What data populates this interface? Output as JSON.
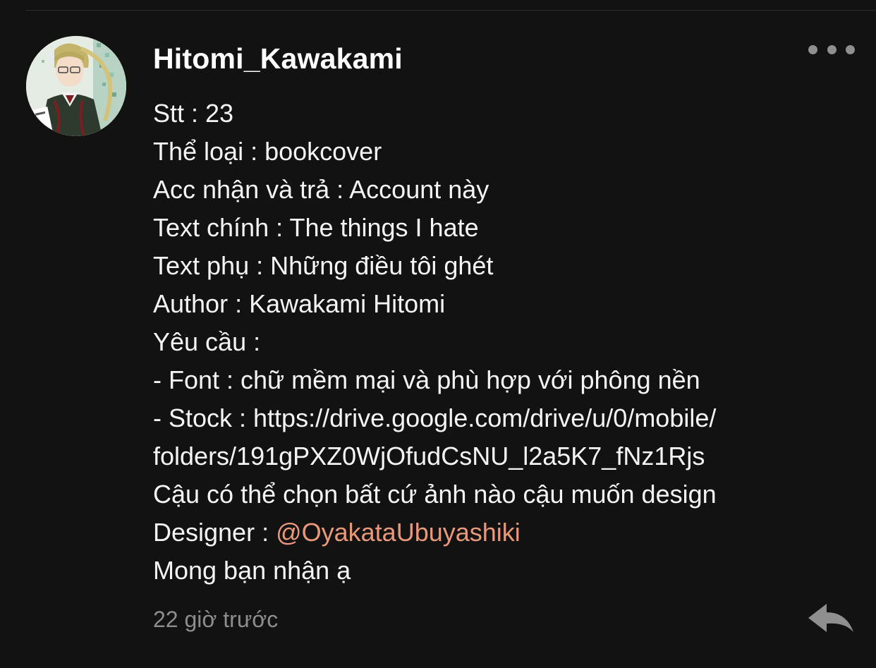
{
  "post": {
    "username": "Hitomi_Kawakami",
    "lines": {
      "stt": "Stt : 23",
      "the_loai": "Thể loại : bookcover",
      "acc": "Acc nhận và trả : Account này",
      "text_chinh": "Text chính : The things I hate",
      "text_phu": "Text phụ : Những điều tôi ghét",
      "author": "Author : Kawakami Hitomi",
      "yeu_cau": "Yêu cầu :",
      "font": "- Font : chữ mềm mại và phù hợp với phông nền",
      "stock": "- Stock : https://drive.google.com/drive/u/0/mobile/",
      "stock_cont": "folders/191gPXZ0WjOfudCsNU_l2a5K7_fNz1Rjs",
      "choose": "Cậu có thể chọn bất cứ ảnh nào cậu muốn design",
      "designer_label": "Designer : ",
      "designer_mention": "@OyakataUbuyashiki",
      "closing": "Mong bạn nhận ạ"
    },
    "timestamp": "22 giờ trước"
  },
  "icons": {
    "more": "more-horizontal-icon",
    "reply": "reply-arrow-icon"
  },
  "colors": {
    "background": "#121212",
    "text": "#f4f4f4",
    "mention": "#e9997a",
    "muted": "#8d8d8d",
    "icon": "#8f8f8f"
  }
}
